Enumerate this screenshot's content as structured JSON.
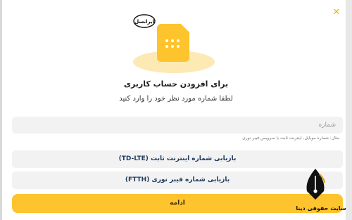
{
  "icons": {
    "close": "close-icon",
    "sim": "sim-card-icon",
    "brand_logo": "irancell-logo",
    "watermark": "pen-nib-icon"
  },
  "brand": {
    "logo_text": "ایرانسل"
  },
  "header": {
    "title": "برای افزودن حساب کاربری",
    "subtitle": "لطفا شماره مورد نظر خود را وارد کنید"
  },
  "form": {
    "phone_placeholder": "شماره",
    "phone_value": "",
    "hint": "مثال: شماره موبایل، اینترنت ثابت یا سرویس فیبر نوری"
  },
  "options": [
    {
      "label": "بازیابی شماره اینترنت ثابت (TD-LTE)"
    },
    {
      "label": "بازیابی شماره فیبر نوری (FTTH)"
    }
  ],
  "actions": {
    "continue_label": "ادامه"
  },
  "watermark": {
    "text": "سایت حقوقی دینا"
  },
  "colors": {
    "accent": "#fec42d",
    "close": "#f4b400",
    "input_bg": "#f2f2f2",
    "option_text": "#1f3a5f"
  }
}
